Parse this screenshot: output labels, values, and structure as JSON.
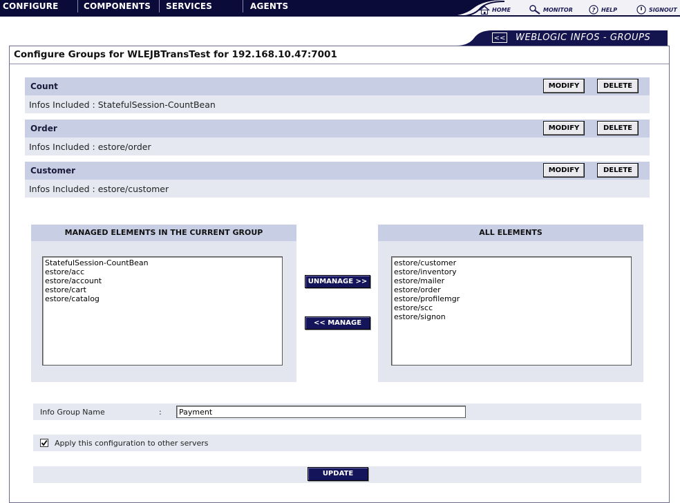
{
  "nav": {
    "items": [
      "CONFIGURE",
      "COMPONENTS",
      "SERVICES",
      "AGENTS"
    ],
    "links": [
      {
        "label": "HOME",
        "icon": "home-icon"
      },
      {
        "label": "MONITOR",
        "icon": "magnifier-icon"
      },
      {
        "label": "HELP",
        "icon": "help-icon"
      },
      {
        "label": "SIGNOUT",
        "icon": "power-icon"
      }
    ]
  },
  "banner": {
    "collapse_label": "<<",
    "title": "WEBLOGIC INFOS - GROUPS"
  },
  "page": {
    "title": "Configure Groups for WLEJBTransTest for  192.168.10.47:7001"
  },
  "groups": [
    {
      "name": "Count",
      "info": "Infos Included : StatefulSession-CountBean",
      "modify_label": "MODIFY",
      "delete_label": "DELETE"
    },
    {
      "name": "Order",
      "info": "Infos Included : estore/order",
      "modify_label": "MODIFY",
      "delete_label": "DELETE"
    },
    {
      "name": "Customer",
      "info": "Infos Included : estore/customer",
      "modify_label": "MODIFY",
      "delete_label": "DELETE"
    }
  ],
  "managed": {
    "title": "MANAGED ELEMENTS IN THE CURRENT GROUP",
    "items": [
      "StatefulSession-CountBean",
      "estore/acc",
      "estore/account",
      "estore/cart",
      "estore/catalog"
    ]
  },
  "all": {
    "title": "ALL ELEMENTS",
    "items": [
      "estore/customer",
      "estore/inventory",
      "estore/mailer",
      "estore/order",
      "estore/profilemgr",
      "estore/scc",
      "estore/signon"
    ]
  },
  "actions": {
    "unmanage_label": "UNMANAGE >>",
    "manage_label": "<< MANAGE",
    "update_label": "UPDATE"
  },
  "form": {
    "group_name_label": "Info Group Name",
    "colon": ":",
    "group_name_value": "Payment",
    "apply_label": "Apply this configuration to other servers",
    "apply_checked": true
  },
  "colors": {
    "nav_dark": "#0b0b3a",
    "header_band": "#c8cfe4",
    "body_band": "#e5e8f1",
    "dark_button": "#14145a"
  }
}
